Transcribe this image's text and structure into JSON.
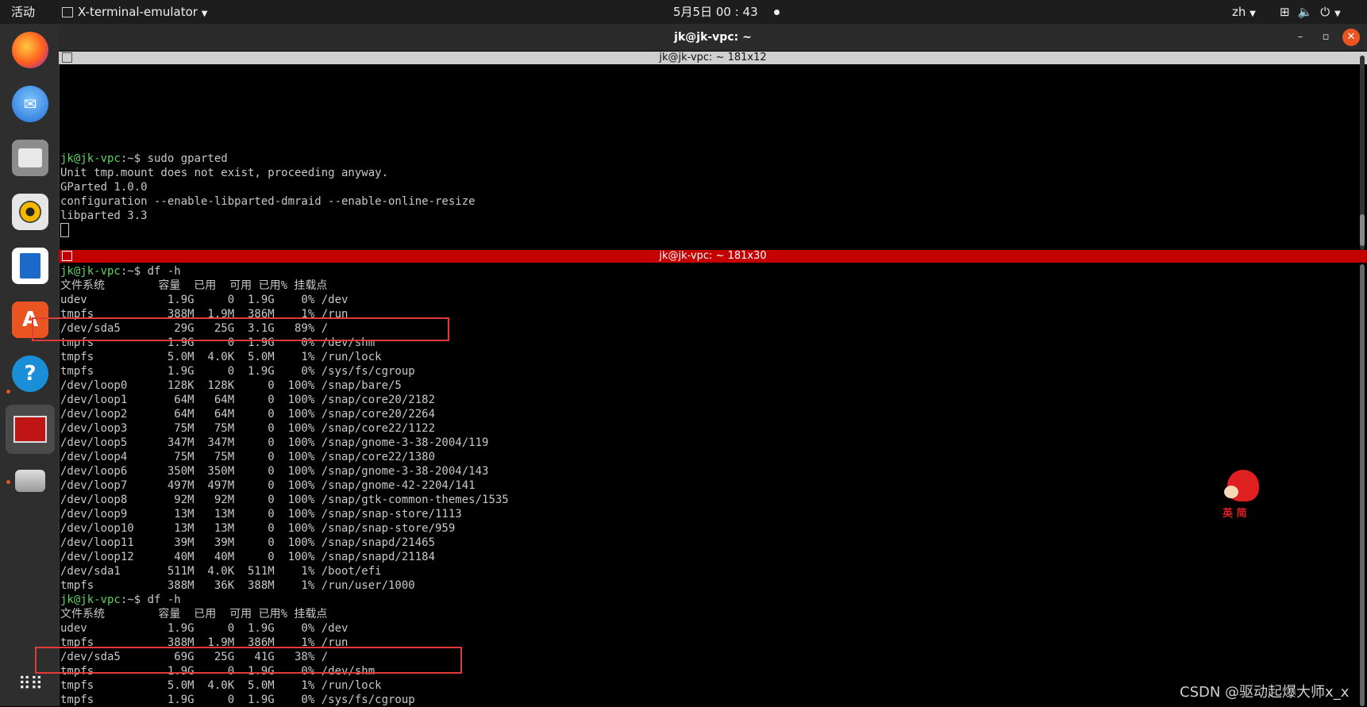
{
  "topbar": {
    "activities": "活动",
    "app_menu": "X-terminal-emulator",
    "clock": "5月5日  00 : 43",
    "lang": "zh",
    "icons": [
      "network-icon",
      "volume-icon",
      "power-icon"
    ]
  },
  "dock": {
    "items": [
      "firefox-icon",
      "thunderbird-icon",
      "files-icon",
      "rhythmbox-icon",
      "writer-icon",
      "software-center-icon",
      "help-icon",
      "terminal-icon",
      "gparted-icon",
      "app-grid-icon"
    ]
  },
  "window": {
    "title": "jk@jk-vpc: ~",
    "minimize": "–",
    "maximize": "▫",
    "close": "✕"
  },
  "pane1": {
    "header": "jk@jk-vpc: ~ 181x12",
    "prompt": "jk@jk-vpc",
    "prompt_rest": ":~$ sudo gparted",
    "lines": [
      "Unit tmp.mount does not exist, proceeding anyway.",
      "GParted 1.0.0",
      "configuration --enable-libparted-dmraid --enable-online-resize",
      "libparted 3.3"
    ]
  },
  "pane2": {
    "header": "jk@jk-vpc: ~ 181x30",
    "block1_prompt": "jk@jk-vpc",
    "block1_cmd": ":~$ df -h",
    "block1": [
      "文件系统        容量  已用  可用 已用% 挂载点",
      "udev            1.9G     0  1.9G    0% /dev",
      "tmpfs           388M  1.9M  386M    1% /run",
      "/dev/sda5        29G   25G  3.1G   89% /",
      "tmpfs           1.9G     0  1.9G    0% /dev/shm",
      "tmpfs           5.0M  4.0K  5.0M    1% /run/lock",
      "tmpfs           1.9G     0  1.9G    0% /sys/fs/cgroup",
      "/dev/loop0      128K  128K     0  100% /snap/bare/5",
      "/dev/loop1       64M   64M     0  100% /snap/core20/2182",
      "/dev/loop2       64M   64M     0  100% /snap/core20/2264",
      "/dev/loop3       75M   75M     0  100% /snap/core22/1122",
      "/dev/loop5      347M  347M     0  100% /snap/gnome-3-38-2004/119",
      "/dev/loop4       75M   75M     0  100% /snap/core22/1380",
      "/dev/loop6      350M  350M     0  100% /snap/gnome-3-38-2004/143",
      "/dev/loop7      497M  497M     0  100% /snap/gnome-42-2204/141",
      "/dev/loop8       92M   92M     0  100% /snap/gtk-common-themes/1535",
      "/dev/loop9       13M   13M     0  100% /snap/snap-store/1113",
      "/dev/loop10      13M   13M     0  100% /snap/snap-store/959",
      "/dev/loop11      39M   39M     0  100% /snap/snapd/21465",
      "/dev/loop12      40M   40M     0  100% /snap/snapd/21184",
      "/dev/sda1       511M  4.0K  511M    1% /boot/efi",
      "tmpfs           388M   36K  388M    1% /run/user/1000"
    ],
    "block2_prompt": "jk@jk-vpc",
    "block2_cmd": ":~$ df -h",
    "block2": [
      "文件系统        容量  已用  可用 已用% 挂载点",
      "udev            1.9G     0  1.9G    0% /dev",
      "tmpfs           388M  1.9M  386M    1% /run",
      "/dev/sda5        69G   25G   41G   38% /",
      "tmpfs           1.9G     0  1.9G    0% /dev/shm",
      "tmpfs           5.0M  4.0K  5.0M    1% /run/lock",
      "tmpfs           1.9G     0  1.9G    0% /sys/fs/cgroup"
    ]
  },
  "mascot_text": "英 简",
  "watermark": "CSDN @驱动起爆大师x_x",
  "colors": {
    "pane_active_header": "#c40000",
    "pane_inactive_header": "#cfcfcf",
    "prompt": "#5fd35f",
    "highlight_box": "#e03a3a"
  }
}
